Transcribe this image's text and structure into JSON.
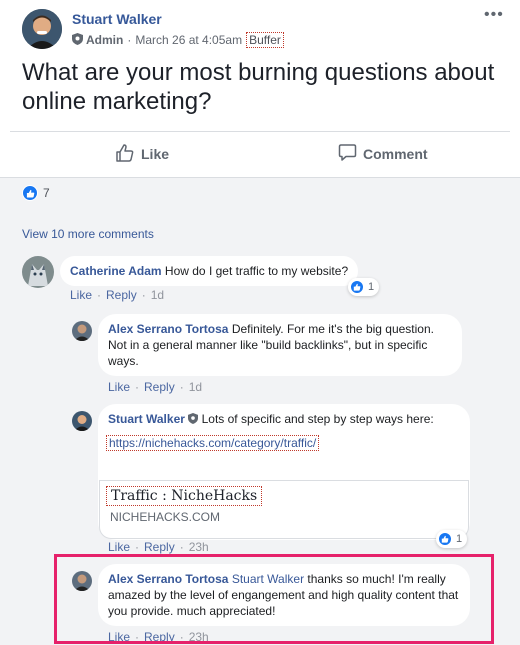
{
  "post": {
    "author": "Stuart Walker",
    "role": "Admin",
    "timestamp": "March 26 at 4:05am",
    "via": "Buffer",
    "text": "What are your most burning questions about online marketing?",
    "more_icon": "ellipsis-icon"
  },
  "actions": {
    "like_label": "Like",
    "comment_label": "Comment"
  },
  "reactions": {
    "count": "7"
  },
  "view_more": "View 10 more comments",
  "comments": [
    {
      "author": "Catherine Adam",
      "text": "How do I get traffic to my website?",
      "like": "Like",
      "reply": "Reply",
      "time": "1d",
      "reaction_count": "1"
    }
  ],
  "replies": [
    {
      "author": "Alex Serrano Tortosa",
      "text": "Definitely. For me it's the big question. Not in a general manner like \"build backlinks\", but in specific ways.",
      "like": "Like",
      "reply": "Reply",
      "time": "1d"
    },
    {
      "author": "Stuart Walker",
      "text": "Lots of specific and step by step ways here:",
      "link": "https://nichehacks.com/category/traffic/",
      "preview_title": "Traffic : NicheHacks",
      "preview_domain": "NICHEHACKS.COM",
      "like": "Like",
      "reply": "Reply",
      "time": "23h",
      "reaction_count": "1"
    },
    {
      "author": "Alex Serrano Tortosa",
      "mention": "Stuart Walker",
      "text": "thanks so much! I'm really amazed by the level of engangement and high quality content that you provide. much appreciated!",
      "like": "Like",
      "reply": "Reply",
      "time": "23h"
    }
  ],
  "colors": {
    "link_blue": "#385898",
    "like_blue": "#1877f2",
    "highlight": "#e6216a",
    "gray_bg": "#f2f3f5"
  }
}
